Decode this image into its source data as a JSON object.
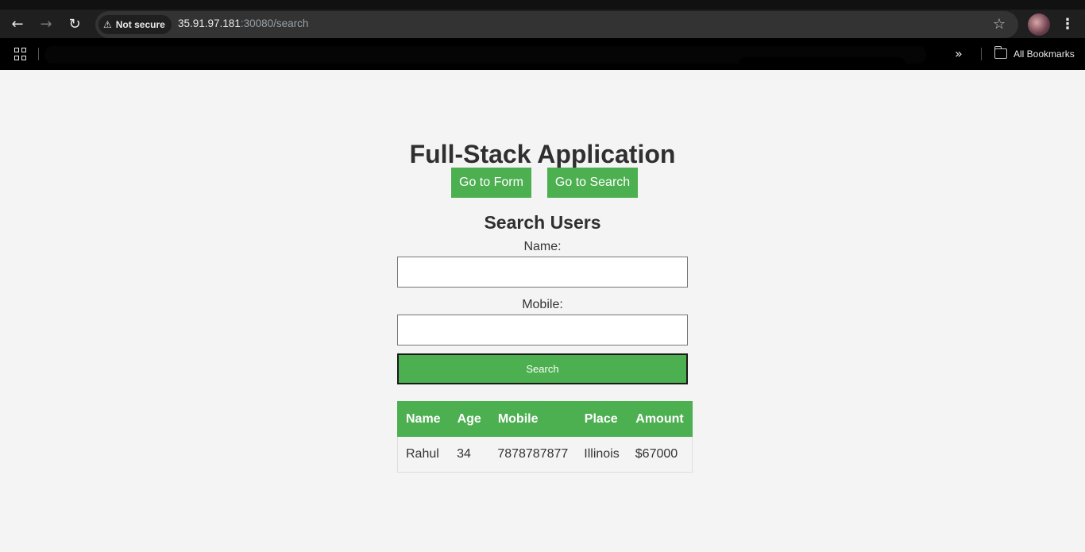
{
  "browser": {
    "security_label": "Not secure",
    "url_host": "35.91.97.181",
    "url_rest": ":30080/search",
    "bookmarks_label": "All Bookmarks"
  },
  "page": {
    "title": "Full-Stack Application",
    "nav_links": [
      "Go to Form",
      "Go to Search"
    ],
    "subtitle": "Search Users",
    "name_label": "Name:",
    "name_value": "",
    "mobile_label": "Mobile:",
    "mobile_value": "",
    "search_button": "Search"
  },
  "table": {
    "headers": [
      "Name",
      "Age",
      "Mobile",
      "Place",
      "Amount"
    ],
    "rows": [
      [
        "Rahul",
        "34",
        "7878787877",
        "Illinois",
        "$67000"
      ]
    ]
  },
  "colors": {
    "accent": "#4caf50",
    "page_bg": "#f4f4f4"
  },
  "icons": [
    "back-icon",
    "forward-icon",
    "reload-icon",
    "warning-icon",
    "star-icon",
    "kebab-menu-icon",
    "apps-icon",
    "chevron-double-right-icon",
    "folder-icon"
  ]
}
